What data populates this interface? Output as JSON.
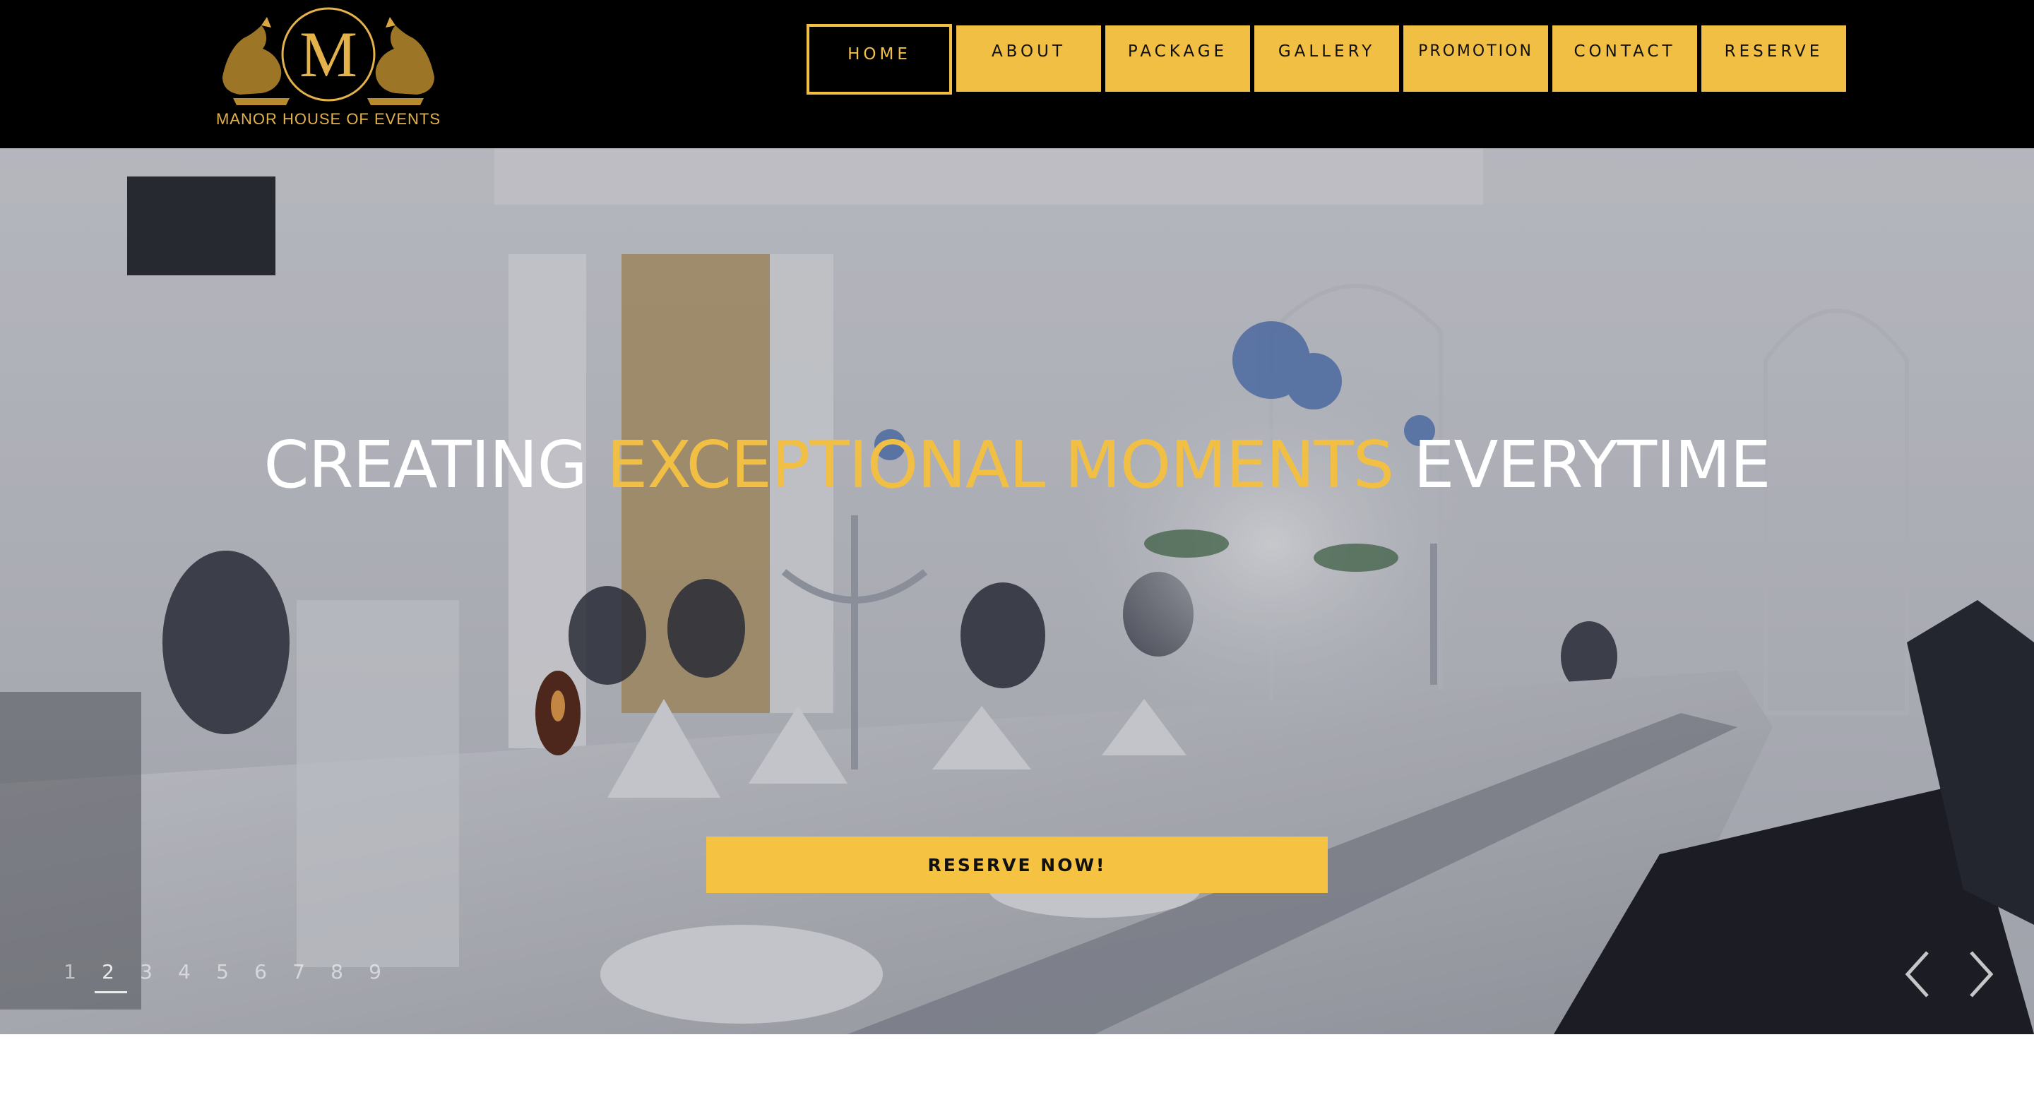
{
  "brand": {
    "monogram": "M",
    "name": "MANOR HOUSE OF EVENTS"
  },
  "nav": {
    "items": [
      {
        "label": "HOME",
        "active": true
      },
      {
        "label": "ABOUT",
        "active": false
      },
      {
        "label": "PACKAGE",
        "active": false
      },
      {
        "label": "GALLERY",
        "active": false
      },
      {
        "label": "PROMOTION",
        "active": false
      },
      {
        "label": "CONTACT",
        "active": false
      },
      {
        "label": "RESERVE",
        "active": false
      }
    ]
  },
  "hero": {
    "headline_before": "CREATING ",
    "headline_accent": "EXCEPTIONAL MOMENTS",
    "headline_after": " EVERYTIME",
    "cta_label": "RESERVE NOW!",
    "slides": [
      "1",
      "2",
      "3",
      "4",
      "5",
      "6",
      "7",
      "8",
      "9"
    ],
    "active_slide": "2",
    "prev_icon": "chevron-left-icon",
    "next_icon": "chevron-right-icon"
  },
  "colors": {
    "accent": "#f2bf45",
    "header_bg": "#000000",
    "logo_gold": "#e3b24a"
  }
}
